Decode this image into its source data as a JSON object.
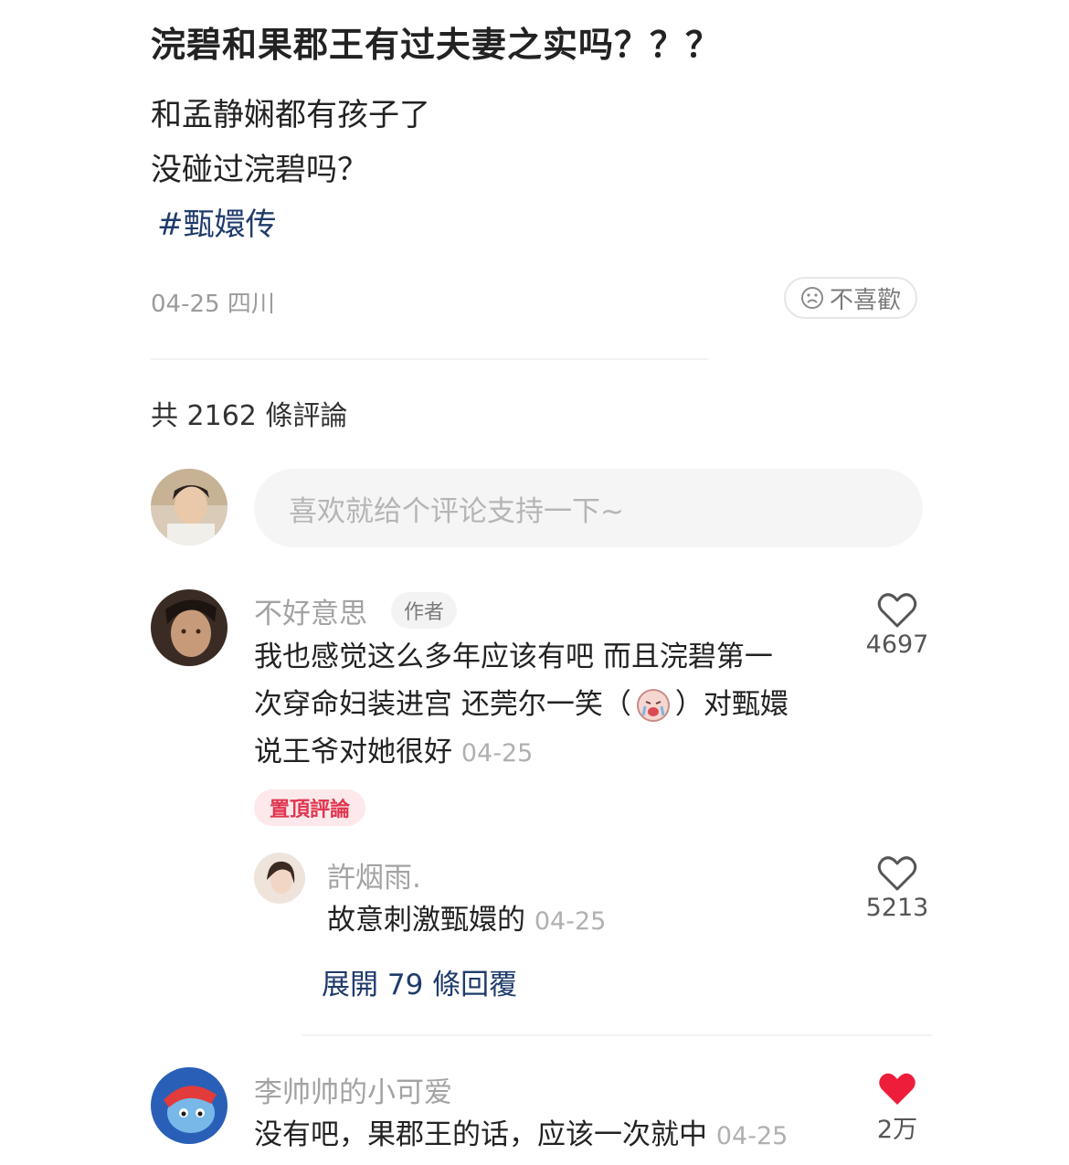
{
  "post": {
    "title": "浣碧和果郡王有过夫妻之实吗？？？",
    "body_lines": [
      "和孟静娴都有孩子了",
      "没碰过浣碧吗？"
    ],
    "hashtag": "#甄嬛传",
    "meta": "04-25 四川",
    "dislike_label": "不喜歡"
  },
  "comments_header": {
    "count_label": "共 2162 條評論",
    "input_placeholder": "喜欢就给个评论支持一下~"
  },
  "comments": [
    {
      "username": "不好意思",
      "badge": "作者",
      "lines": [
        "我也感觉这么多年应该有吧 而且浣碧第一",
        "次穿命妇装进宫 还莞尔一笑（",
        "）对甄嬛",
        "说王爷对她很好"
      ],
      "date": "04-25",
      "pinned_label": "置頂評論",
      "likes": "4697",
      "avatar_color": "#3a2c24"
    },
    {
      "username": "許烟雨.",
      "text": "故意刺激甄嬛的",
      "date": "04-25",
      "likes": "5213",
      "avatar_color": "#e9d9cf"
    },
    {
      "username": "李帅帅的小可爱",
      "text": "没有吧，果郡王的话，应该一次就中",
      "date": "04-25",
      "likes": "2万",
      "avatar_color": "#2a5fb8"
    }
  ],
  "expand_replies_label": "展開 79 條回覆",
  "colors": {
    "like_active": "#ee1d3a",
    "link": "#1f3b6b",
    "pinned": "#e0364f"
  }
}
